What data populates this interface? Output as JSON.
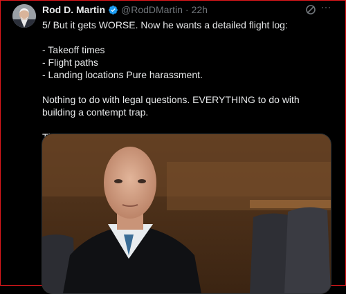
{
  "tweet": {
    "author_name": "Rod D. Martin",
    "handle": "@RodDMartin",
    "separator": "·",
    "time": "22h",
    "more_label": "···",
    "lines": {
      "l1": "5/ But it gets WORSE. Now he wants a detailed flight log:",
      "l2": "- Takeoff times",
      "l3": "- Flight paths",
      "l4": "- Landing locations Pure harassment.",
      "l5": "Nothing to do with legal questions. EVERYTHING to do with building a contempt trap.",
      "l6": "The lawfare never ends."
    }
  },
  "icons": {
    "verified": "verified-badge-icon",
    "grok": "grok-icon",
    "more": "more-icon"
  },
  "colors": {
    "background": "#000000",
    "text": "#e7e9ea",
    "secondary": "#71767b",
    "verified": "#1d9bf0",
    "frame": "#e0181c"
  }
}
